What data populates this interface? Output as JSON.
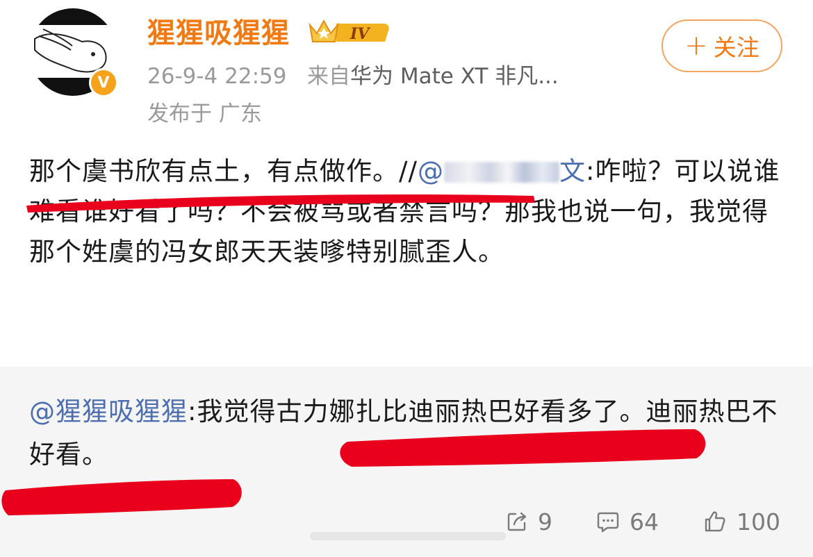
{
  "header": {
    "username": "猩猩吸猩猩",
    "vip_level": "IV",
    "verified_badge": "V",
    "timestamp": "26-9-4 22:59",
    "source_prefix": "来自",
    "device": "华为 Mate XT 非凡...",
    "location": "发布于 广东",
    "follow_label": "关注"
  },
  "post": {
    "text_before": "那个虞书欣有点土，有点做作。//",
    "mention_prefix": "@",
    "mention_tail": "文",
    "text_after": ":咋啦？可以说谁难看谁好看了吗？不会被骂或者禁言吗？那我也说一句，我觉得那个姓虞的冯女郎天天装嗲特别腻歪人。"
  },
  "repost": {
    "mention": "@猩猩吸猩猩",
    "text": ":我觉得古力娜扎比迪丽热巴好看多了。迪丽热巴不好看。"
  },
  "actions": {
    "share_count": "9",
    "comment_count": "64",
    "like_count": "100"
  },
  "colors": {
    "username": "#f27a13",
    "mention": "#4c6eb0",
    "marker": "#e8001c",
    "vip_gold": "#f3b21f"
  }
}
